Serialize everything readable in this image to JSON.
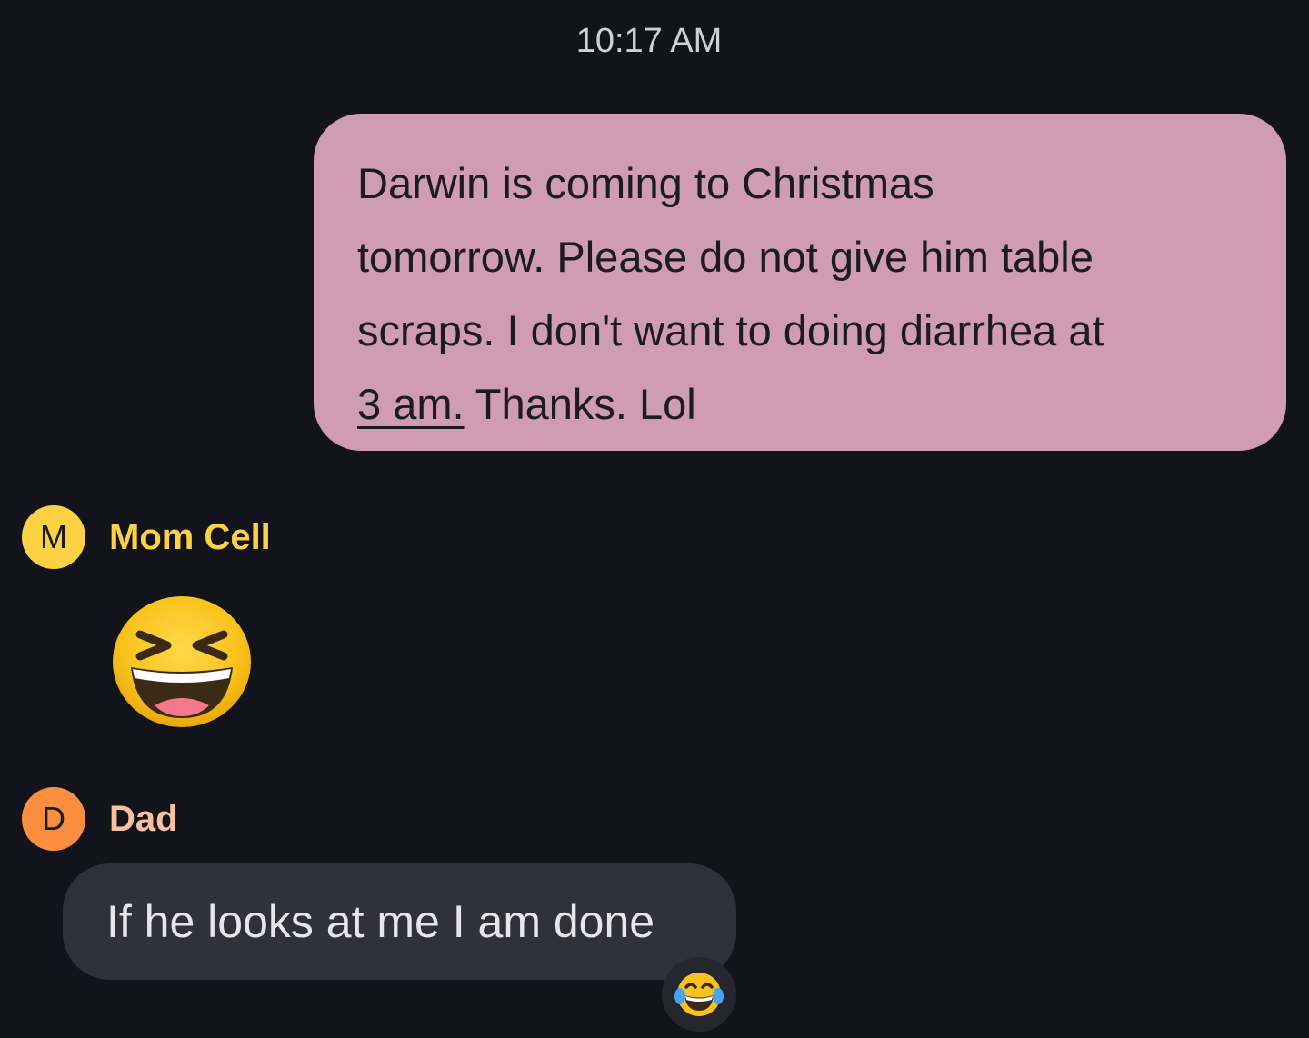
{
  "conversation": {
    "timestamp": "10:17 AM",
    "outgoing_message": {
      "lines": [
        "Darwin is coming to Christmas",
        "tomorrow. Please do not give him table",
        "scraps. I don't want to doing diarrhea at"
      ],
      "link_text": "3 am.",
      "last_line_rest": " Thanks. Lol"
    },
    "participants": [
      {
        "initial": "M",
        "name": "Mom Cell",
        "color": "#fcd144",
        "name_color": "#fcd144"
      },
      {
        "initial": "D",
        "name": "Dad",
        "color": "#fb8f3f",
        "name_color": "#fcc09f"
      }
    ],
    "mom_message": {
      "emoji": "grinning-squinting-face-emoji"
    },
    "dad_message": {
      "text": "If he looks at me I am done",
      "reaction": "face-with-tears-of-joy-emoji"
    },
    "colors": {
      "background": "#13141b",
      "outgoing_bubble": "#cf9cb3",
      "incoming_bubble": "#30313a"
    }
  }
}
